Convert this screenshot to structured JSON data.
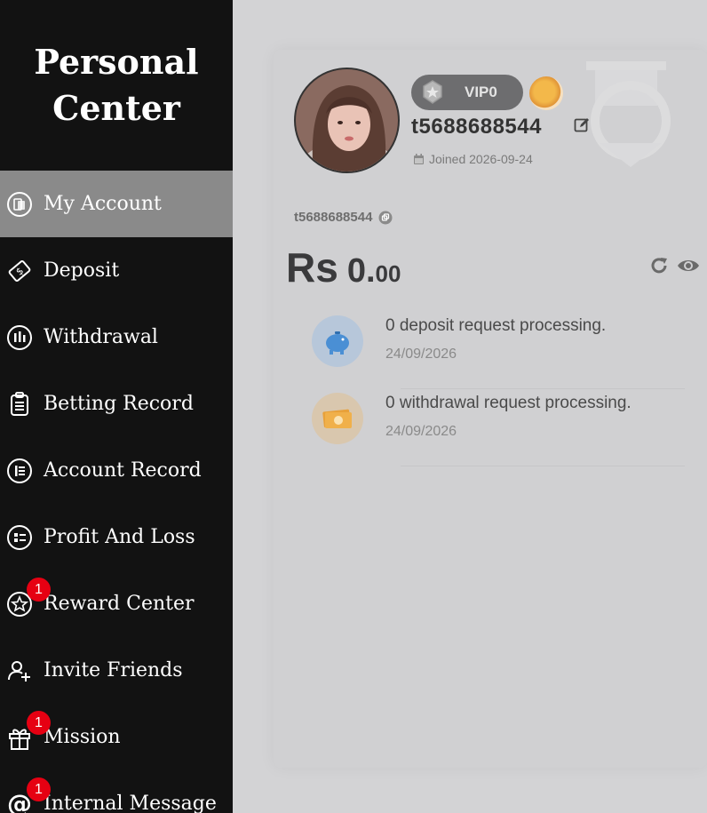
{
  "sidebar": {
    "title": "Personal Center",
    "items": [
      {
        "label": "My Account",
        "icon": "account-icon",
        "active": true,
        "badge": ""
      },
      {
        "label": "Deposit",
        "icon": "deposit-icon",
        "active": false,
        "badge": ""
      },
      {
        "label": "Withdrawal",
        "icon": "withdrawal-icon",
        "active": false,
        "badge": ""
      },
      {
        "label": "Betting Record",
        "icon": "clipboard-icon",
        "active": false,
        "badge": ""
      },
      {
        "label": "Account Record",
        "icon": "record-icon",
        "active": false,
        "badge": ""
      },
      {
        "label": "Profit And Loss",
        "icon": "list-icon",
        "active": false,
        "badge": ""
      },
      {
        "label": "Reward Center",
        "icon": "star-icon",
        "active": false,
        "badge": "1"
      },
      {
        "label": "Invite Friends",
        "icon": "add-user-icon",
        "active": false,
        "badge": ""
      },
      {
        "label": "Mission",
        "icon": "gift-icon",
        "active": false,
        "badge": "1"
      },
      {
        "label": "Internal Message",
        "icon": "at-icon",
        "active": false,
        "badge": "1"
      }
    ]
  },
  "profile": {
    "vip_label": "VIP0",
    "username": "t5688688544",
    "joined": "Joined 2026-09-24",
    "uid": "t5688688544"
  },
  "balance": {
    "currency": "Rs",
    "integer": "0.",
    "decimal": "00"
  },
  "requests": [
    {
      "text": "0  deposit request processing.",
      "date": "24/09/2026",
      "color": "#b7c7da",
      "icon": "piggy-bank-icon"
    },
    {
      "text": "0  withdrawal request processing.",
      "date": "24/09/2026",
      "color": "#d9c7ae",
      "icon": "cash-icon"
    }
  ],
  "colors": {
    "sidebar_bg": "#121212",
    "active_bg": "#8a8a8a",
    "badge": "#e60012",
    "card_bg": "#d0d0d2"
  }
}
